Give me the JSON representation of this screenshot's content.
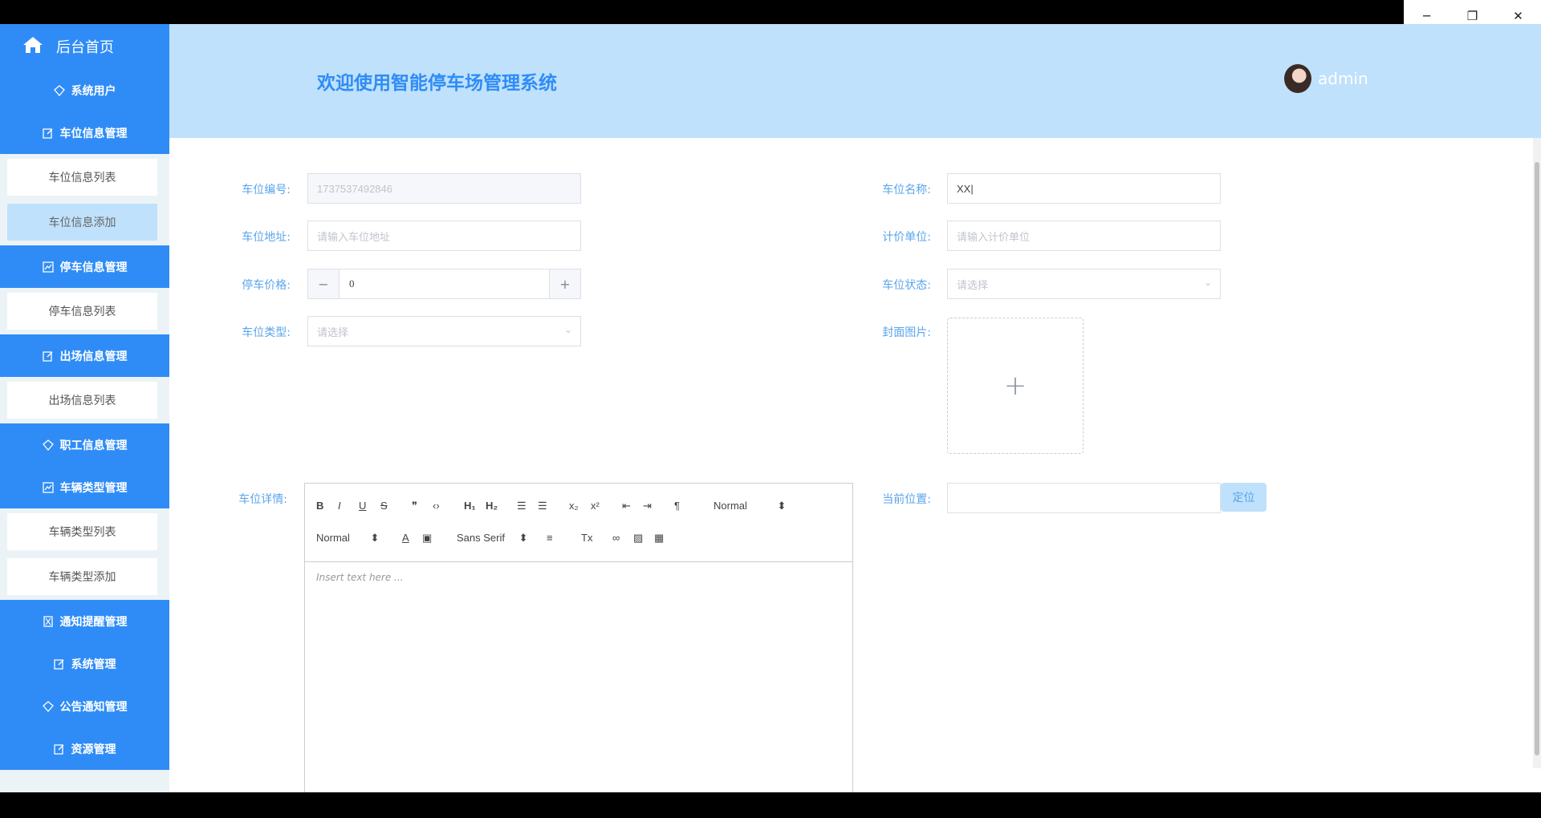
{
  "window": {
    "minimize": "─",
    "restore": "❐",
    "close": "✕"
  },
  "sidebar": {
    "home_label": "后台首页",
    "menus": [
      {
        "label": "系统用户",
        "icon": "diamond-icon",
        "subs": []
      },
      {
        "label": "车位信息管理",
        "icon": "edit-icon",
        "subs": [
          {
            "label": "车位信息列表"
          },
          {
            "label": "车位信息添加",
            "active": true
          }
        ]
      },
      {
        "label": "停车信息管理",
        "icon": "chart-icon",
        "subs": [
          {
            "label": "停车信息列表"
          }
        ]
      },
      {
        "label": "出场信息管理",
        "icon": "edit-icon",
        "subs": [
          {
            "label": "出场信息列表"
          }
        ]
      },
      {
        "label": "职工信息管理",
        "icon": "diamond-icon",
        "subs": []
      },
      {
        "label": "车辆类型管理",
        "icon": "chart-icon",
        "subs": [
          {
            "label": "车辆类型列表"
          },
          {
            "label": "车辆类型添加"
          }
        ]
      },
      {
        "label": "通知提醒管理",
        "icon": "hourglass-icon",
        "subs": []
      },
      {
        "label": "系统管理",
        "icon": "edit-icon",
        "subs": []
      },
      {
        "label": "公告通知管理",
        "icon": "diamond-icon",
        "subs": []
      },
      {
        "label": "资源管理",
        "icon": "edit-icon",
        "subs": []
      }
    ]
  },
  "header": {
    "title": "欢迎使用智能停车场管理系统",
    "username": "admin"
  },
  "form": {
    "spot_no": {
      "label": "车位编号:",
      "value": "1737537492846"
    },
    "spot_name": {
      "label": "车位名称:",
      "value": "XX|"
    },
    "address": {
      "label": "车位地址:",
      "placeholder": "请输入车位地址"
    },
    "unit": {
      "label": "计价单位:",
      "placeholder": "请输入计价单位"
    },
    "price": {
      "label": "停车价格:",
      "value": "0",
      "minus": "−",
      "plus": "+"
    },
    "status": {
      "label": "车位状态:",
      "placeholder": "请选择"
    },
    "type": {
      "label": "车位类型:",
      "placeholder": "请选择"
    },
    "cover": {
      "label": "封面图片:",
      "plus": "+"
    },
    "detail": {
      "label": "车位详情:"
    },
    "location": {
      "label": "当前位置:",
      "button": "定位"
    }
  },
  "editor": {
    "bold": "B",
    "italic": "I",
    "underline": "U",
    "strike": "S",
    "quote": "❞",
    "code": "‹›",
    "h1": "H₁",
    "h2": "H₂",
    "ol": "☰",
    "ul": "☰",
    "sub": "x₂",
    "sup": "x²",
    "indent_less": "⇤",
    "indent_more": "⇥",
    "direction": "¶",
    "header_select": "Normal",
    "size_select": "Normal",
    "color": "A",
    "bg": "▣",
    "font_select": "Sans Serif",
    "align": "≡",
    "clean": "Tx",
    "link": "∞",
    "image": "▨",
    "video": "▦",
    "placeholder": "Insert text here ..."
  }
}
